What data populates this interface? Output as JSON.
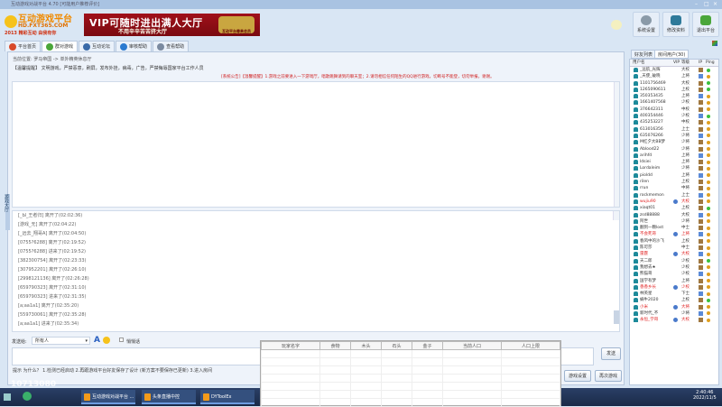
{
  "window": {
    "title": "互动游戏对战平台 4.70 [可能用户推荐评价]",
    "controls": [
      "–",
      "□",
      "×"
    ]
  },
  "logo": {
    "text": "互动游戏平台",
    "url": "HD.FXT365.COM",
    "slogan": "2013 精彩互动 由我有你"
  },
  "banner": {
    "line1": "VIP可随时进出满人大厅",
    "line2": "不用辛辛苦苦挤大厅",
    "badge": "互动平台尊贵会员"
  },
  "top_buttons": [
    {
      "label": "系统设置",
      "icon": "gear-icon"
    },
    {
      "label": "修改资料",
      "icon": "home-icon"
    },
    {
      "label": "退出平台",
      "icon": "exit-icon"
    }
  ],
  "tabs": [
    {
      "label": "平台首页",
      "icon": "home-icon"
    },
    {
      "label": "群对游戏",
      "icon": "chat-icon"
    },
    {
      "label": "互动论坛",
      "icon": "forum-icon"
    },
    {
      "label": "审核帮助",
      "icon": "help-icon"
    },
    {
      "label": "查看帮助",
      "icon": "info-icon"
    }
  ],
  "main": {
    "location": "当前位置: 罗马帝国 -> 单外精英休息厅",
    "rules": "【温馨提醒】 文明游戏，严禁恶意，刷屏，发布外挂，病毒，广告，严禁侮辱国家平台工作人员",
    "notice": "[系统公告]【温馨提醒】1.游戏之前要进入一下游戏厅，唱歌跳舞请到的聊天室；2.请勿相信任何陌生的QQ进行游戏，切断号不能登，切勿举报，谢谢。",
    "log": [
      "[_Ы_王者归] 离开了(02:02:36)",
      "[游戏_无] 离开了(02:04:22)",
      "[_远去_翔哥A] 离开了(02:04:50)",
      "[0755?6288] 离开了(02:19:52)",
      "[0755?6288] 进来了(02:19:52)",
      "[382300754] 离开了(02:23:33)",
      "[307952201] 离开了(02:26:10)",
      "[2998121136] 离开了(02:26:28)",
      "[659790323] 离开了(02:31:10)",
      "[659790323] 进来了(02:31:35)",
      "[a;aa1a1] 离开了(02:35:20)",
      "[559730061] 离开了(02:35:28)",
      "[a;aa1a1] 进来了(02:35:34)"
    ],
    "send_to_label": "发送给:",
    "send_to_value": "所有人",
    "private_label": "悄悄话",
    "send_button": "发送",
    "hint": "提示   为什么？ 1.检测已经启动   2.再跟游戏平台好友保存了设计 (新方案不要保存已更新)   3.进入房间",
    "buttons": [
      "游戏设置",
      "再次游戏"
    ]
  },
  "side_tab": "游戏大厅",
  "right": {
    "tabs": [
      "好友列表",
      "房间用户(30)"
    ],
    "headers": [
      "用户名",
      "VIP",
      "等级",
      "IP",
      "Ping"
    ],
    "users": [
      {
        "name": "_远航_光辉",
        "level": "大校",
        "vip": false,
        "ping": "#3cc03c"
      },
      {
        "name": "_天使_破晓",
        "level": "上将",
        "vip": false,
        "ping": "#e0a020"
      },
      {
        "name": "1101756469",
        "level": "大校",
        "vip": false,
        "ping": "#3cc03c"
      },
      {
        "name": "1265090611",
        "level": "上校",
        "vip": false,
        "ping": "#3cc03c"
      },
      {
        "name": "350353435",
        "level": "上将",
        "vip": false,
        "ping": "#e0a020"
      },
      {
        "name": "1661407568",
        "level": "少校",
        "vip": false,
        "ping": "#e0a020"
      },
      {
        "name": "376642311",
        "level": "中校",
        "vip": false,
        "ping": "#e0a020"
      },
      {
        "name": "400354446",
        "level": "少校",
        "vip": false,
        "ping": "#3cc03c"
      },
      {
        "name": "435253227",
        "level": "中校",
        "vip": false,
        "ping": "#e0a020"
      },
      {
        "name": "613016356",
        "level": "上士",
        "vip": false,
        "ping": "#e0a020"
      },
      {
        "name": "635076266",
        "level": "少将",
        "vip": false,
        "ping": "#e0a020"
      },
      {
        "name": "M红夕大BB梦",
        "level": "少将",
        "vip": false,
        "ping": "#e0a020"
      },
      {
        "name": "Ablood22",
        "level": "少将",
        "vip": false,
        "ping": "#e0a020"
      },
      {
        "name": "arihfd",
        "level": "上将",
        "vip": false,
        "ping": "#e0a020"
      },
      {
        "name": "ldsiei",
        "level": "上将",
        "vip": false,
        "ping": "#e0a020"
      },
      {
        "name": "Lordaleim",
        "level": "少将",
        "vip": false,
        "ping": "#e0a020"
      },
      {
        "name": "pioldd",
        "level": "上将",
        "vip": false,
        "ping": "#e0a020"
      },
      {
        "name": "rilen",
        "level": "上校",
        "vip": false,
        "ping": "#e0a020"
      },
      {
        "name": "rrun",
        "level": "中将",
        "vip": false,
        "ping": "#e0a020"
      },
      {
        "name": "rockmemon",
        "level": "上士",
        "vip": false,
        "ping": "#e0a020"
      },
      {
        "name": "wujiu90",
        "level": "大校",
        "vip": true,
        "ping": "#e0a020"
      },
      {
        "name": "xiaqt01",
        "level": "上校",
        "vip": false,
        "ping": "#3cc03c"
      },
      {
        "name": "zsd88888",
        "level": "大校",
        "vip": false,
        "ping": "#e0a020"
      },
      {
        "name": "阿世",
        "level": "少将",
        "vip": false,
        "ping": "#e0a020"
      },
      {
        "name": "翻到一颗lost",
        "level": "中士",
        "vip": false,
        "ping": "#e0a020"
      },
      {
        "name": "不会死哥",
        "level": "上将",
        "vip": true,
        "ping": "#e0a020"
      },
      {
        "name": "春风中的沙飞",
        "level": "上校",
        "vip": false,
        "ping": "#e0a020"
      },
      {
        "name": "陈可莎",
        "level": "中士",
        "vip": false,
        "ping": "#e0a020"
      },
      {
        "name": "雷霆",
        "level": "大校",
        "vip": true,
        "ping": "#e0a020"
      },
      {
        "name": "天二郎",
        "level": "少校",
        "vip": false,
        "ping": "#3cc03c"
      },
      {
        "name": "我想去★",
        "level": "少校",
        "vip": false,
        "ping": "#e0a020"
      },
      {
        "name": "熊猫哥",
        "level": "少校",
        "vip": false,
        "ping": "#e0a020"
      },
      {
        "name": "国学有梦",
        "level": "上将",
        "vip": false,
        "ping": "#e0a020"
      },
      {
        "name": "香香乡长",
        "level": "少校",
        "vip": true,
        "ping": "#e0a020"
      },
      {
        "name": "林英星",
        "level": "下士",
        "vip": false,
        "ping": "#e0a020"
      },
      {
        "name": "蜗牛2020",
        "level": "上校",
        "vip": false,
        "ping": "#3cc03c"
      },
      {
        "name": "小米",
        "level": "大将",
        "vip": true,
        "ping": "#e0a020"
      },
      {
        "name": "新时代_不",
        "level": "少将",
        "vip": false,
        "ping": "#e0a020"
      },
      {
        "name": "永恒_学哥",
        "level": "大校",
        "vip": true,
        "ping": "#e0a020"
      }
    ]
  },
  "overlay_table": {
    "headers": [
      "玩家名字",
      "食物",
      "木头",
      "石头",
      "金子",
      "当前人口",
      "人口上限"
    ]
  },
  "taskbar": {
    "watermark": "10713080",
    "tasks": [
      "互动游戏对战平台 ...",
      "头条直播中控",
      "DYToolEx"
    ],
    "time": "2:40:46",
    "date": "2022/11/5"
  }
}
